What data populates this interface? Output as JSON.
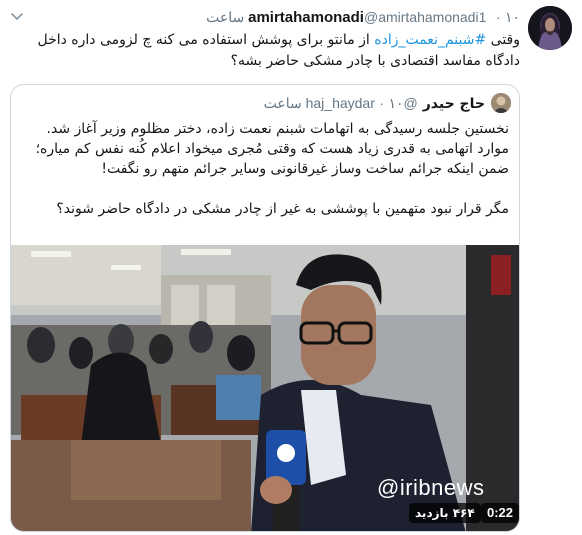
{
  "tweet": {
    "author_name": "amirtahamonadi",
    "author_handle": "@amirtahamonadi1",
    "separator": "·",
    "time": "۱۰ ساعت",
    "text_before_hashtag": "وقتی ",
    "hashtag": "#شبنم_نعمت_زاده",
    "text_after_hashtag": " از مانتو برای پوشش استفاده می کنه چ لزومی داره داخل دادگاه مفاسد اقتصادی با چادر مشکی حاضر بشه؟",
    "avatar_icon": "avatar-icon",
    "menu_icon": "chevron-down-icon"
  },
  "quote": {
    "author_name": "حاج حیدر",
    "author_handle": "@haj_haydar",
    "separator": "·",
    "time": "۱۰ ساعت",
    "paragraphs": [
      "نخستین جلسه رسیدگی به اتهامات شبنم نعمت زاده، دختر مظلوم وزیر آغاز شد.",
      "موارد اتهامی به قدری زیاد هست که وقتی مُجری میخواد اعلام کُنه نفس کم میاره؛ ضمن اینکه جرائم ساخت وساز غیرقانونی وسایر جرائم متهم رو نگفت!",
      "مگر قرار نبود متهمین با پوششی به غیر از چادر مشکی در دادگاه حاضر شوند؟"
    ],
    "video": {
      "watermark": "@iribnews",
      "duration": "0:22",
      "views": "۴۶۴ بازدید"
    }
  },
  "colors": {
    "link": "#1b95e0",
    "muted": "#657786",
    "border": "#ccd6dd"
  }
}
